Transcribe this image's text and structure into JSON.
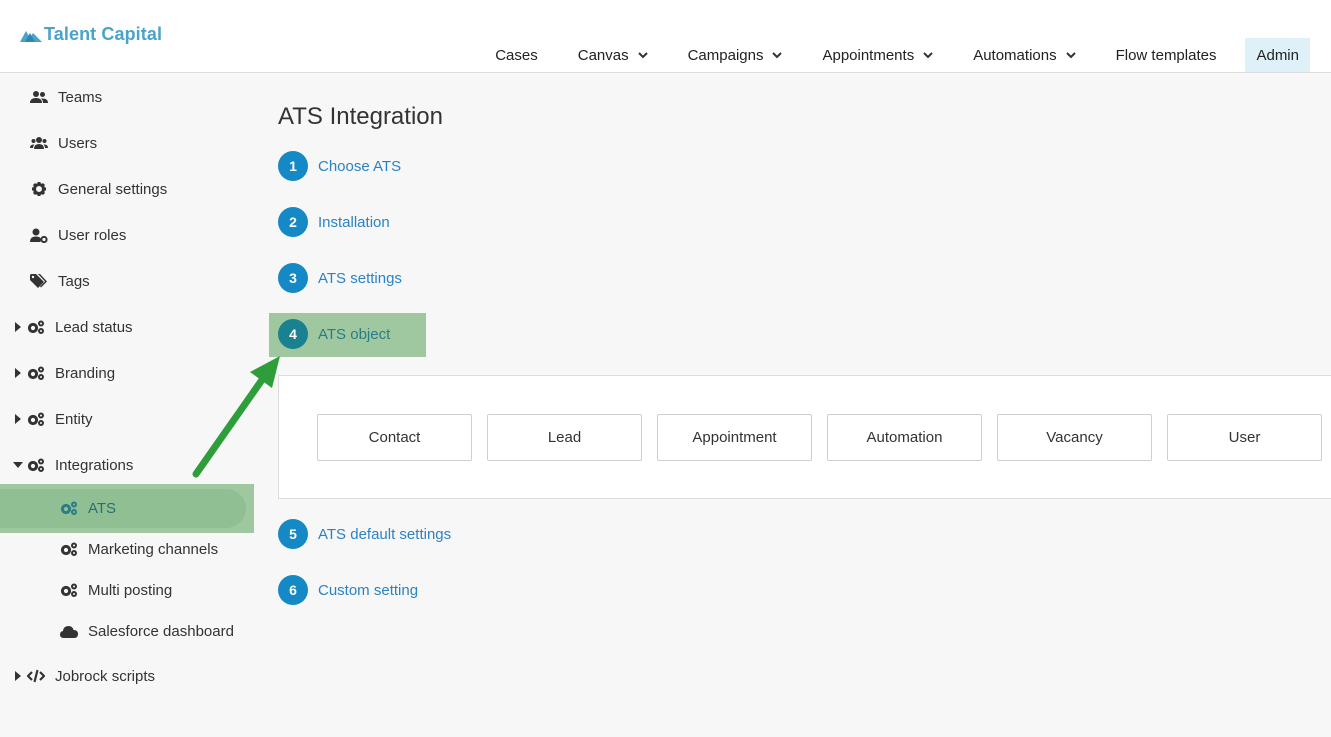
{
  "brand": {
    "name": "Talent Capital",
    "color": "#4aa3c9"
  },
  "nav": {
    "items": [
      {
        "label": "Cases",
        "dropdown": false
      },
      {
        "label": "Canvas",
        "dropdown": true
      },
      {
        "label": "Campaigns",
        "dropdown": true
      },
      {
        "label": "Appointments",
        "dropdown": true
      },
      {
        "label": "Automations",
        "dropdown": true
      },
      {
        "label": "Flow templates",
        "dropdown": false
      },
      {
        "label": "Admin",
        "dropdown": false,
        "active": true
      }
    ]
  },
  "sidebar": {
    "items": [
      {
        "label": "Teams",
        "icon": "users-icon"
      },
      {
        "label": "Users",
        "icon": "user-group-icon"
      },
      {
        "label": "General settings",
        "icon": "gear-icon"
      },
      {
        "label": "User roles",
        "icon": "user-cog-icon"
      },
      {
        "label": "Tags",
        "icon": "tags-icon"
      },
      {
        "label": "Lead status",
        "icon": "cogs-icon",
        "expandable": true
      },
      {
        "label": "Branding",
        "icon": "cogs-icon",
        "expandable": true
      },
      {
        "label": "Entity",
        "icon": "cogs-icon",
        "expandable": true
      },
      {
        "label": "Integrations",
        "icon": "cogs-icon",
        "expandable": true,
        "expanded": true
      },
      {
        "label": "ATS",
        "icon": "cogs-icon",
        "child": true,
        "active": true
      },
      {
        "label": "Marketing channels",
        "icon": "cogs-icon",
        "child": true
      },
      {
        "label": "Multi posting",
        "icon": "cogs-icon",
        "child": true
      },
      {
        "label": "Salesforce dashboard",
        "icon": "cloud-icon",
        "child": true
      },
      {
        "label": "Jobrock scripts",
        "icon": "code-icon",
        "expandable": true
      }
    ]
  },
  "main": {
    "title": "ATS Integration",
    "steps": [
      {
        "num": "1",
        "label": "Choose ATS"
      },
      {
        "num": "2",
        "label": "Installation"
      },
      {
        "num": "3",
        "label": "ATS settings"
      },
      {
        "num": "4",
        "label": "ATS object",
        "active": true
      },
      {
        "num": "5",
        "label": "ATS default settings"
      },
      {
        "num": "6",
        "label": "Custom setting"
      }
    ],
    "objects": [
      "Contact",
      "Lead",
      "Appointment",
      "Automation",
      "Vacancy",
      "User"
    ]
  },
  "colors": {
    "step_blue": "#1589c6",
    "highlight_green": "#9fc8a0",
    "arrow_green": "#2e9e3a"
  }
}
